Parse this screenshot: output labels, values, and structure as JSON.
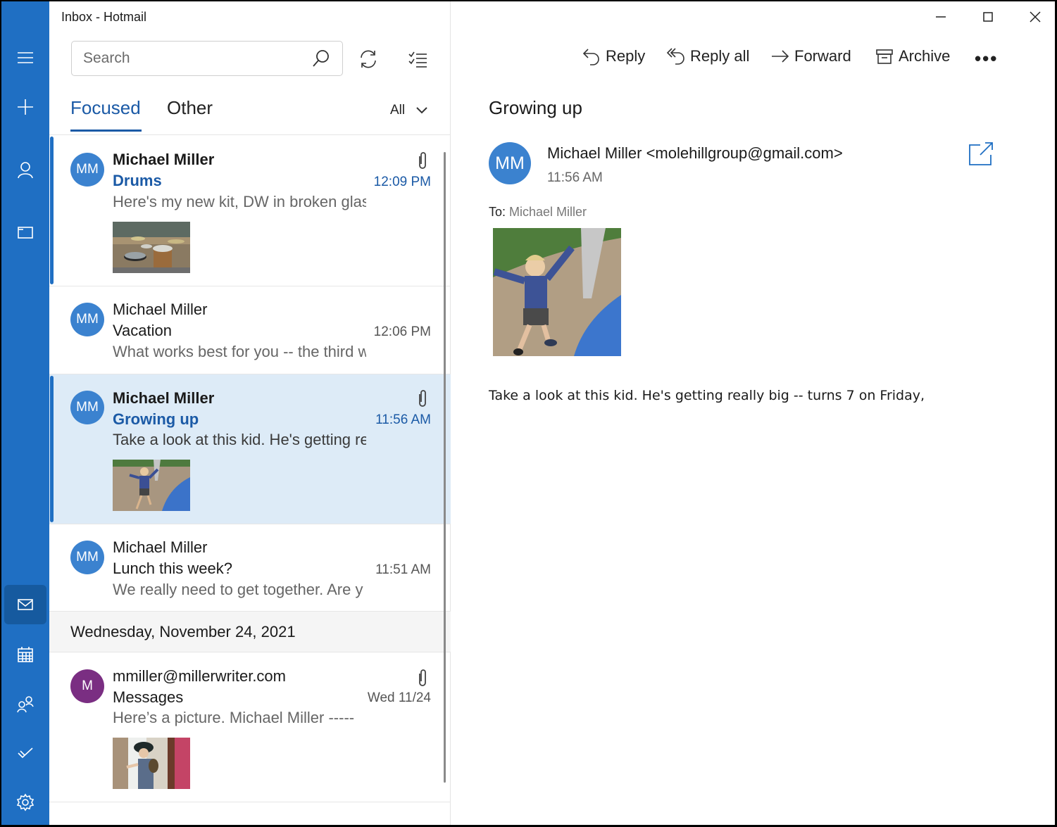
{
  "window": {
    "title": "Inbox - Hotmail",
    "minimize_label": "Minimize",
    "maximize_label": "Maximize",
    "close_label": "Close"
  },
  "colors": {
    "rail": "#1f6fc3",
    "accent": "#1b5aa6",
    "selected_row": "#ddebf7",
    "avatar_blue": "#3b82cf",
    "avatar_purple": "#7a2e82"
  },
  "rail": {
    "top_items": [
      {
        "icon": "hamburger-menu-icon",
        "label": "Menu"
      },
      {
        "icon": "plus-icon",
        "label": "New mail"
      },
      {
        "icon": "person-icon",
        "label": "Accounts"
      },
      {
        "icon": "folder-icon",
        "label": "Folders"
      }
    ],
    "bottom_items": [
      {
        "icon": "mail-icon",
        "label": "Mail",
        "active": true
      },
      {
        "icon": "calendar-icon",
        "label": "Calendar"
      },
      {
        "icon": "people-icon",
        "label": "People"
      },
      {
        "icon": "todo-check-icon",
        "label": "To Do"
      },
      {
        "icon": "settings-gear-icon",
        "label": "Settings"
      }
    ]
  },
  "list": {
    "search": {
      "placeholder": "Search",
      "value": ""
    },
    "tabs": [
      {
        "label": "Focused",
        "active": true
      },
      {
        "label": "Other",
        "active": false
      }
    ],
    "filter": {
      "selected": "All"
    },
    "messages": [
      {
        "initials": "MM",
        "sender": "Michael Miller",
        "subject": "Drums",
        "time": "12:09 PM",
        "preview": "Here's my new kit, DW in broken glas",
        "unread": true,
        "attachment": true,
        "selected": false
      },
      {
        "initials": "MM",
        "sender": "Michael Miller",
        "subject": "Vacation",
        "time": "12:06 PM",
        "preview": "What works best for you -- the third w",
        "unread": false,
        "attachment": false,
        "selected": false
      },
      {
        "initials": "MM",
        "sender": "Michael Miller",
        "subject": "Growing up",
        "time": "11:56 AM",
        "preview": "Take a look at this kid. He's getting re",
        "unread": true,
        "attachment": true,
        "selected": true
      },
      {
        "initials": "MM",
        "sender": "Michael Miller",
        "subject": "Lunch this week?",
        "time": "11:51 AM",
        "preview": "We really need to get together. Are y",
        "unread": false,
        "attachment": false,
        "selected": false
      }
    ],
    "date_group": "Wednesday, November 24, 2021",
    "older_messages": [
      {
        "initials": "M",
        "sender": "mmiller@millerwriter.com",
        "subject": "Messages",
        "time": "Wed 11/24",
        "preview": "Here’s a picture. Michael Miller -----",
        "unread": false,
        "attachment": true,
        "selected": false
      }
    ]
  },
  "reading": {
    "actions": {
      "reply": "Reply",
      "reply_all": "Reply all",
      "forward": "Forward",
      "archive": "Archive",
      "more": "•••"
    },
    "subject": "Growing up",
    "avatar_initials": "MM",
    "from": "Michael Miller <molehillgroup@gmail.com>",
    "time": "11:56 AM",
    "to_label": "To:",
    "to_name": "Michael Miller",
    "body": "Take a look at this kid. He's getting really big -- turns 7 on Friday,"
  }
}
